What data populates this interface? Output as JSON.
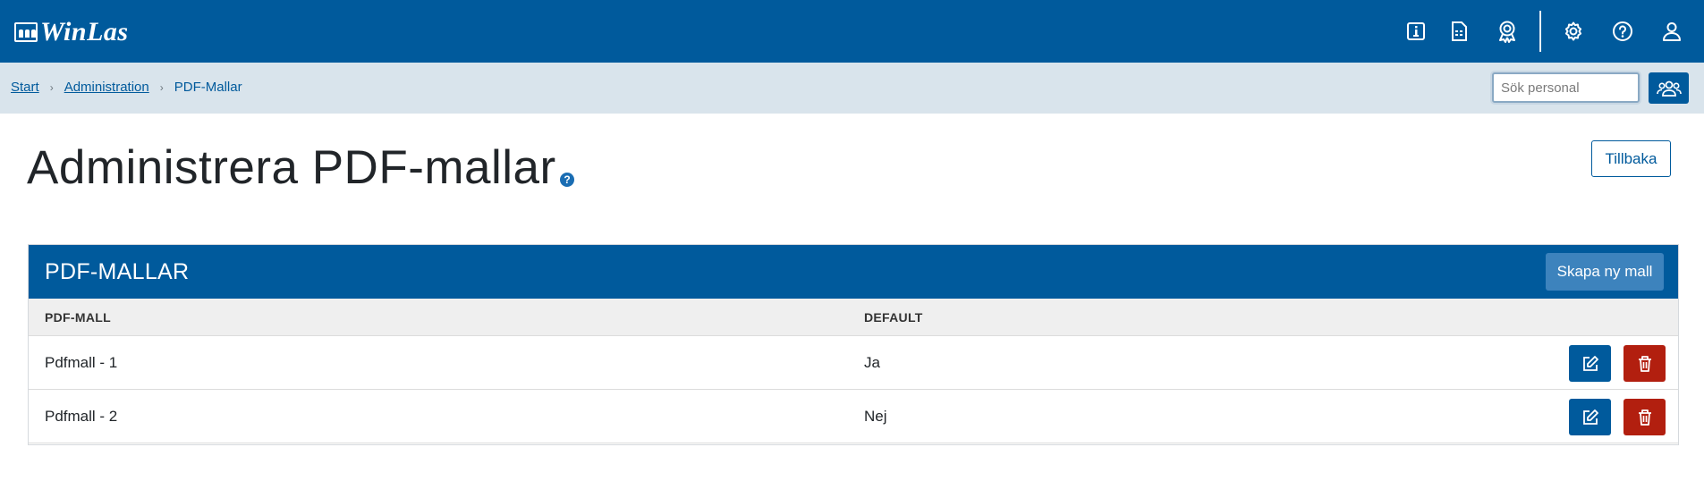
{
  "header": {
    "logo_text": "WinLas",
    "icons": [
      "info-icon",
      "calculator-icon",
      "award-icon",
      "gear-icon",
      "help-icon",
      "user-icon"
    ]
  },
  "breadcrumb": {
    "items": [
      "Start",
      "Administration"
    ],
    "current": "PDF-Mallar"
  },
  "search": {
    "placeholder": "Sök personal"
  },
  "page": {
    "title": "Administrera PDF-mallar",
    "help_glyph": "?",
    "back_label": "Tillbaka"
  },
  "card": {
    "title": "PDF-MALLAR",
    "create_label": "Skapa ny mall",
    "columns": [
      "PDF-MALL",
      "DEFAULT"
    ],
    "rows": [
      {
        "name": "Pdfmall - 1",
        "default": "Ja"
      },
      {
        "name": "Pdfmall - 2",
        "default": "Nej"
      }
    ]
  },
  "colors": {
    "primary": "#005a9c",
    "danger": "#b21f0f",
    "crumb_bg": "#d9e4ec"
  }
}
